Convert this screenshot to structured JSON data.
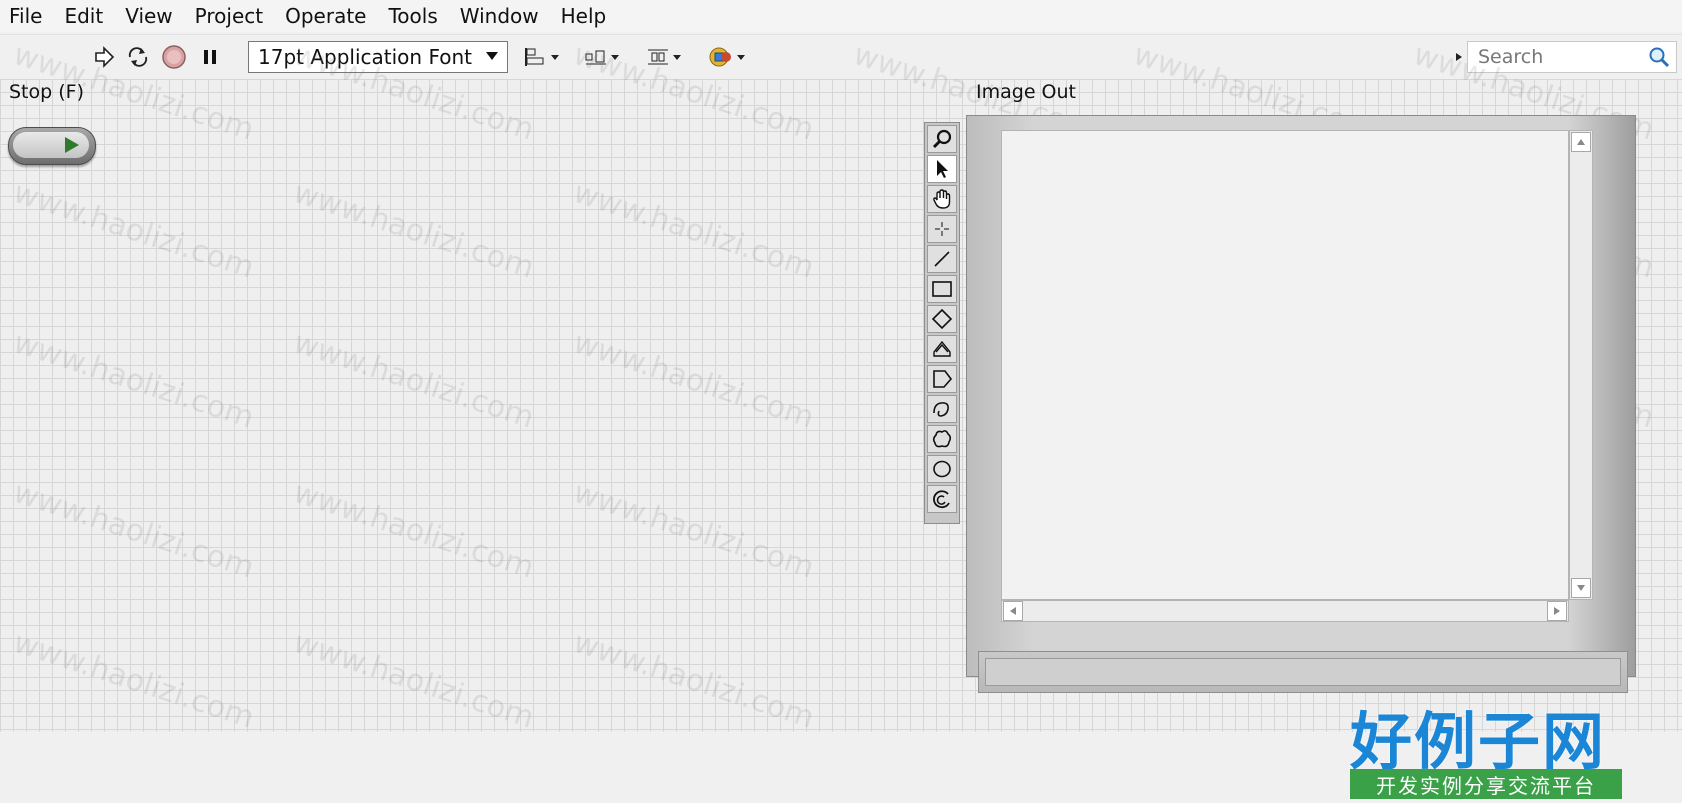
{
  "menu": [
    "File",
    "Edit",
    "View",
    "Project",
    "Operate",
    "Tools",
    "Window",
    "Help"
  ],
  "toolbar": {
    "font": "17pt Application Font",
    "search_placeholder": "Search"
  },
  "controls": {
    "stop_label": "Stop (F)",
    "image_label": "Image Out"
  },
  "palette_tools": [
    "zoom-icon",
    "pointer-icon",
    "pan-hand-icon",
    "crosshair-point-icon",
    "line-icon",
    "rectangle-icon",
    "rotated-rectangle-icon",
    "annulus-icon",
    "polygon-icon",
    "freehand-line-icon",
    "freehand-region-icon",
    "oval-icon",
    "annulus-arc-icon"
  ],
  "watermark": {
    "text": "www.haolizi.com",
    "brand": "好例子网",
    "slogan": "开发实例分享交流平台"
  },
  "colors": {
    "brand_blue": "#1b86d6",
    "brand_green": "#3aa148",
    "stop_arrow": "#2f7a2b"
  }
}
